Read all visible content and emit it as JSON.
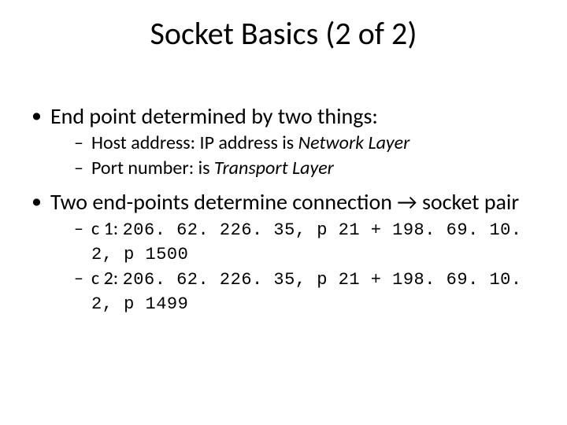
{
  "title": "Socket Basics (2 of 2)",
  "bullets": {
    "b1": {
      "text": "End point determined by two things:",
      "sub": {
        "s1_pre": "Host address: IP address is ",
        "s1_em": "Network Layer",
        "s2_pre": "Port number: is ",
        "s2_em": "Transport Layer"
      }
    },
    "b2": {
      "text": "Two end-points determine connection → socket pair",
      "sub": {
        "c1_label": "c 1: ",
        "c1_code": "206. 62. 226. 35, p 21 + 198. 69. 10. 2, p 1500",
        "c2_label": "c 2: ",
        "c2_code": "206. 62. 226. 35, p 21 + 198. 69. 10. 2, p 1499"
      }
    }
  }
}
